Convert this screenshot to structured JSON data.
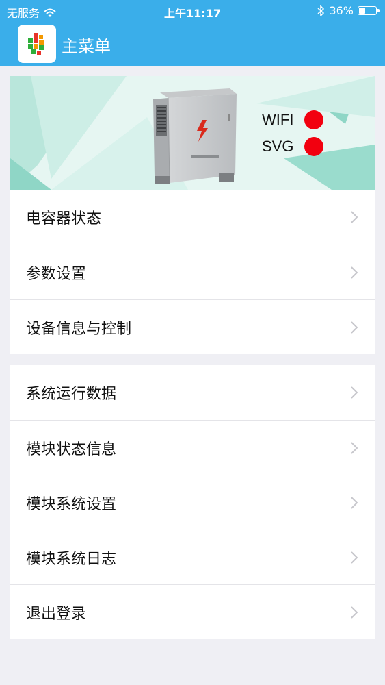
{
  "status_bar": {
    "carrier": "无服务",
    "time": "上午11:17",
    "battery": "36%",
    "battery_level": 0.36,
    "icons": [
      "wifi-icon",
      "bluetooth-icon",
      "battery-icon"
    ]
  },
  "nav": {
    "title": "主菜单",
    "logo_icon": "app-logo-icon"
  },
  "banner": {
    "image": "power-cabinet-image",
    "statuses": [
      {
        "label": "WIFI",
        "color": "#f2000f"
      },
      {
        "label": "SVG",
        "color": "#f2000f"
      }
    ]
  },
  "menu": {
    "group1": [
      {
        "label": "电容器状态"
      },
      {
        "label": "参数设置"
      },
      {
        "label": "设备信息与控制"
      }
    ],
    "group2": [
      {
        "label": "系统运行数据"
      },
      {
        "label": "模块状态信息"
      },
      {
        "label": "模块系统设置"
      },
      {
        "label": "模块系统日志"
      },
      {
        "label": "退出登录"
      }
    ]
  },
  "colors": {
    "header": "#3aaeea",
    "background": "#efeff4",
    "status_red": "#f2000f"
  }
}
